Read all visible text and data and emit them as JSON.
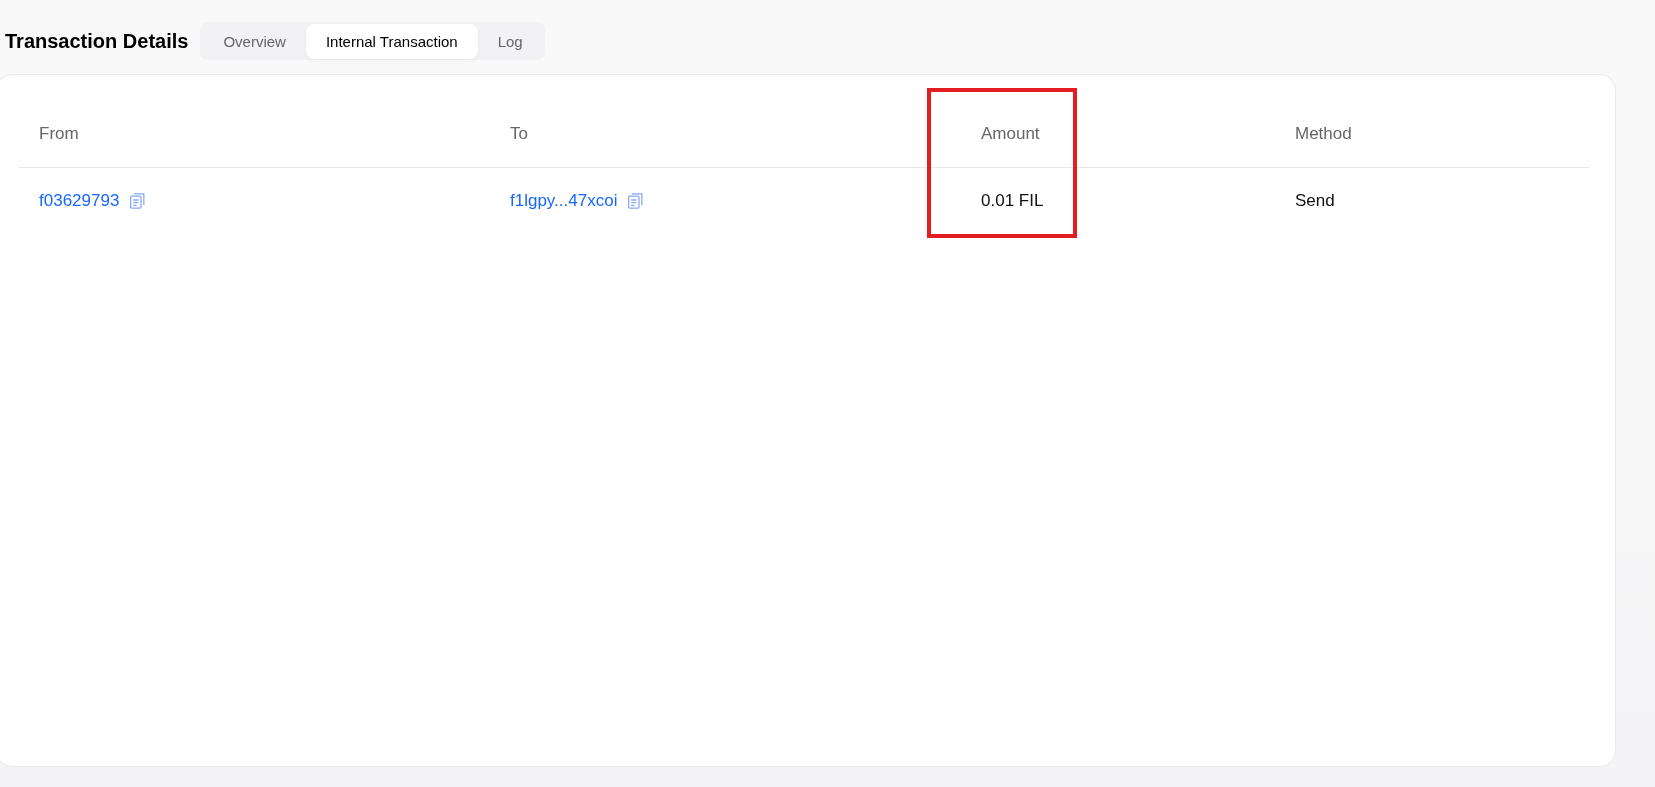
{
  "page": {
    "title": "Transaction Details"
  },
  "tabs": [
    {
      "label": "Overview",
      "selected": false
    },
    {
      "label": "Internal Transaction",
      "selected": true
    },
    {
      "label": "Log",
      "selected": false
    }
  ],
  "table": {
    "columns": [
      {
        "label": "From",
        "highlighted": false
      },
      {
        "label": "To",
        "highlighted": false
      },
      {
        "label": "Amount",
        "highlighted": true
      },
      {
        "label": "Method",
        "highlighted": false
      }
    ],
    "rows": [
      {
        "cells": [
          {
            "kind": "link",
            "text": "f03629793",
            "copyable": true
          },
          {
            "kind": "link",
            "text": "f1lgpy...47xcoi",
            "copyable": true
          },
          {
            "kind": "text",
            "text": "0.01 FIL",
            "copyable": false
          },
          {
            "kind": "text",
            "text": "Send",
            "copyable": false
          }
        ]
      }
    ]
  }
}
